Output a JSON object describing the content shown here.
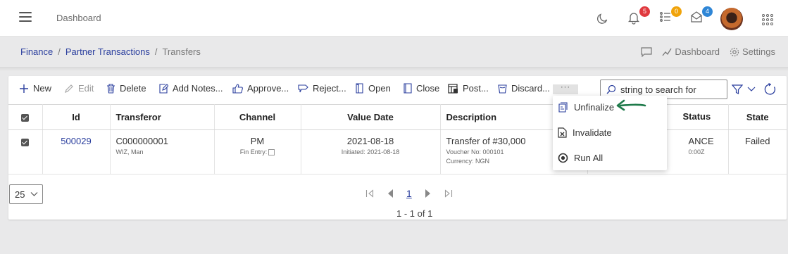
{
  "app": {
    "title": "Dashboard"
  },
  "header": {
    "notifications": {
      "count": "5",
      "color": "#e0393e"
    },
    "tasks": {
      "count": "0",
      "color": "#f0a30a"
    },
    "messages": {
      "count": "4",
      "color": "#2f86d6"
    }
  },
  "breadcrumb": {
    "items": [
      "Finance",
      "Partner Transactions"
    ],
    "current": "Transfers"
  },
  "header_actions": {
    "dashboard": "Dashboard",
    "settings": "Settings"
  },
  "toolbar": {
    "new": "New",
    "edit": "Edit",
    "delete": "Delete",
    "add_notes": "Add Notes...",
    "approve": "Approve...",
    "reject": "Reject...",
    "open": "Open",
    "close": "Close",
    "post": "Post...",
    "discard": "Discard...",
    "more": "···"
  },
  "search": {
    "placeholder": "string to search for"
  },
  "table": {
    "headers": [
      "Id",
      "Transferor",
      "Channel",
      "Value Date",
      "Description",
      "Status",
      "State"
    ],
    "rows": [
      {
        "id": "500029",
        "transferor": "C000000001",
        "transferor_sub": "WIZ, Man",
        "channel": "PM",
        "channel_sub": "Fin Entry:",
        "value_date": "2021-08-18",
        "value_date_sub": "Initiated: 2021-08-18",
        "description": "Transfer of #30,000",
        "description_sub1": "Voucher No: 000101",
        "description_sub2": "Currency: NGN",
        "status": "ANCE",
        "status_sub": "0:00Z",
        "state": "Failed"
      }
    ]
  },
  "pager": {
    "page_size": "25",
    "current_page": "1",
    "info": "1 - 1 of 1"
  },
  "menu": {
    "items": [
      "Unfinalize",
      "Invalidate",
      "Run All"
    ]
  },
  "colors": {
    "accent": "#2b3f9e",
    "arrow": "#1e7a4a"
  }
}
